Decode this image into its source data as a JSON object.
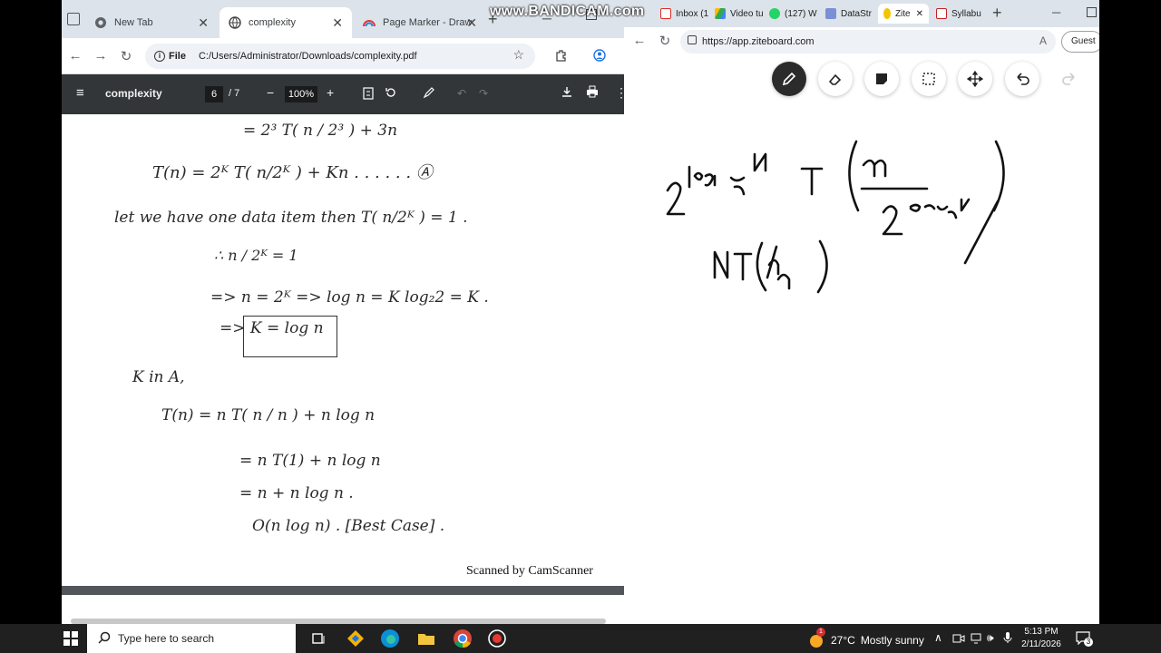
{
  "watermark": "www.BANDICAM.com",
  "left_browser": {
    "tabs": [
      {
        "label": "New Tab",
        "icon": "chrome-icon",
        "active": false
      },
      {
        "label": "complexity",
        "icon": "globe-icon",
        "active": true
      },
      {
        "label": "Page Marker - Draw",
        "icon": "rainbow-icon",
        "active": false
      }
    ],
    "omnibox_chip": "File",
    "url": "C:/Users/Administrator/Downloads/complexity.pdf"
  },
  "pdf_viewer": {
    "title": "complexity",
    "current_page": "6",
    "total_pages": "/ 7",
    "zoom": "100%",
    "scanner_watermark": "Scanned by CamScanner",
    "handwritten_lines": [
      "= 2³ T( n / 2³ ) + 3n",
      "T(n) = 2ᴷ T( n/2ᴷ ) + Kn . . . . . . Ⓐ",
      "let we have one data item then T( n/2ᴷ ) = 1 .",
      "∴  n / 2ᴷ = 1",
      "=> n = 2ᴷ   => log n = K log₂2 = K .",
      "=> K = log n",
      "K  in  A,",
      "T(n) = n T( n / n ) + n log n",
      "= n T(1) + n log n",
      "= n + n log n .",
      "O(n log n) . [Best Case] ."
    ]
  },
  "right_browser": {
    "tabs": [
      {
        "label": "Inbox (1",
        "icon": "gmail-icon"
      },
      {
        "label": "Video tu",
        "icon": "drive-icon"
      },
      {
        "label": "(127) W",
        "icon": "whatsapp-icon"
      },
      {
        "label": "DataStr",
        "icon": "profile-icon"
      },
      {
        "label": "Zite",
        "icon": "ziteboard-icon",
        "active": true
      },
      {
        "label": "Syllabu",
        "icon": "pdf-icon"
      }
    ],
    "url": "https://app.ziteboard.com",
    "guest_label": "Guest"
  },
  "ziteboard": {
    "tools": [
      "pencil-icon",
      "eraser-icon",
      "sticky-note-icon",
      "select-icon",
      "move-icon",
      "undo-icon",
      "redo-icon"
    ],
    "active_tool": "pencil-icon",
    "board_lines": [
      "2^(log₂N) T( n / 2^(log₂N) )",
      "N T( n/n )"
    ]
  },
  "taskbar": {
    "search_placeholder": "Type here to search",
    "weather_temp": "27°C",
    "weather_text": "Mostly sunny",
    "weather_badge": "1",
    "time": "5:13 PM",
    "date": "2/11/2026",
    "notification_count": "3"
  }
}
